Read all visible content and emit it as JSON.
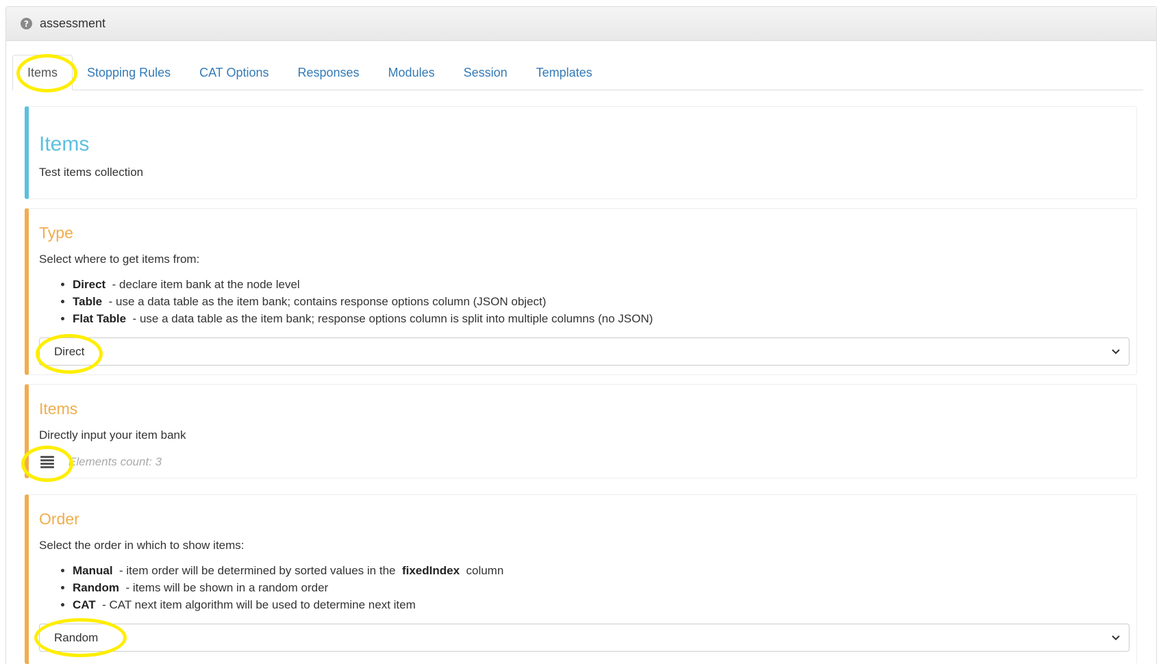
{
  "panel": {
    "title": "assessment",
    "help_icon": "question-circle-icon"
  },
  "tabs": [
    {
      "label": "Items",
      "active": true
    },
    {
      "label": "Stopping Rules",
      "active": false
    },
    {
      "label": "CAT Options",
      "active": false
    },
    {
      "label": "Responses",
      "active": false
    },
    {
      "label": "Modules",
      "active": false
    },
    {
      "label": "Session",
      "active": false
    },
    {
      "label": "Templates",
      "active": false
    }
  ],
  "intro": {
    "title": "Items",
    "description": "Test items collection"
  },
  "type_section": {
    "title": "Type",
    "description": "Select where to get items from:",
    "options": [
      {
        "name": "Direct",
        "text": "declare item bank at the node level"
      },
      {
        "name": "Table",
        "text": "use a data table as the item bank; contains response options column (JSON object)"
      },
      {
        "name": "Flat Table",
        "text": "use a data table as the item bank; response options column is split into multiple columns (no JSON)"
      }
    ],
    "selected": "Direct"
  },
  "items_section": {
    "title": "Items",
    "description": "Directly input your item bank",
    "elements_count": "Elements count: 3",
    "button_icon": "list-icon"
  },
  "order_section": {
    "title": "Order",
    "description": "Select the order in which to show items:",
    "options": [
      {
        "name": "Manual",
        "text": "item order will be determined by sorted values in the",
        "code": "fixedIndex",
        "suffix": "column"
      },
      {
        "name": "Random",
        "text": "items will be shown in a random order"
      },
      {
        "name": "CAT",
        "text": "CAT next item algorithm will be used to determine next item"
      }
    ],
    "selected": "Random"
  },
  "colors": {
    "info": "#5bc0de",
    "warning": "#f0ad4e",
    "link": "#337ab7",
    "highlight": "#ffee00"
  }
}
